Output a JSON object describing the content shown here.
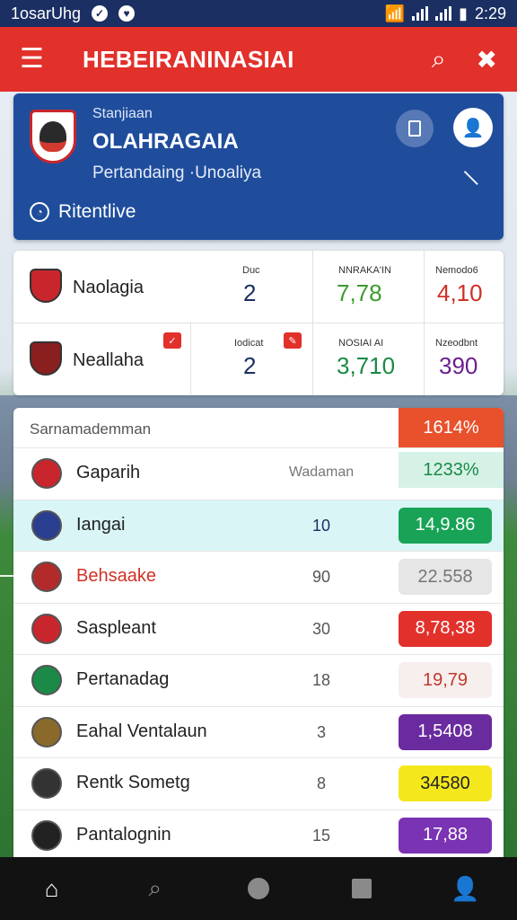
{
  "status_bar": {
    "carrier": "1osarUhg",
    "time": "2:29"
  },
  "app_bar": {
    "title": "HEBEIRANINASIAI"
  },
  "profile": {
    "subtitle": "Stanjiaan",
    "name": "OLAHRAGAIA",
    "description": "Pertandaing ·Unoaliya",
    "live_label": "Ritentlive"
  },
  "matches": [
    {
      "team": "Naolagia",
      "score_label": "Duc",
      "score": "2",
      "odd1_label": "NNRAKA'IN",
      "odd1": "7,78",
      "odd2_label": "Nemodo6",
      "odd2": "4,10",
      "odd1_color": "#3c9b2e",
      "odd2_color": "#d03025"
    },
    {
      "team": "Neallaha",
      "score_label": "Iodicat",
      "score": "2",
      "odd1_label": "NOSIAI AI",
      "odd1": "3,710",
      "odd2_label": "Nzeodbnt",
      "odd2": "390",
      "odd1_color": "#1a8a46",
      "odd2_color": "#6a1f8e"
    }
  ],
  "standings": {
    "header": "Sarnamademman",
    "header_value": "1614%",
    "rows": [
      {
        "name": "Gaparih",
        "value": "Wadaman",
        "score": "1233%",
        "pill_bg": "#d6f2e6",
        "pill_fg": "#1a8a46",
        "name_red": false,
        "highlight": false
      },
      {
        "name": "Iangai",
        "value": "10",
        "score": "14,9.86",
        "pill_bg": "#18a357",
        "pill_fg": "#ffffff",
        "name_red": false,
        "highlight": true
      },
      {
        "name": "Behsaake",
        "value": "90",
        "score": "22.558",
        "pill_bg": "#e6e6e6",
        "pill_fg": "#777777",
        "name_red": true,
        "highlight": false
      },
      {
        "name": "Saspleant",
        "value": "30",
        "score": "8,78,38",
        "pill_bg": "#e2302b",
        "pill_fg": "#ffffff",
        "name_red": false,
        "highlight": false
      },
      {
        "name": "Pertanadag",
        "value": "18",
        "score": "19,79",
        "pill_bg": "#f7eeee",
        "pill_fg": "#c0392b",
        "name_red": false,
        "highlight": false
      },
      {
        "name": "Eahal Ventalaun",
        "value": "3",
        "score": "1,5408",
        "pill_bg": "#6a2b9e",
        "pill_fg": "#ffffff",
        "name_red": false,
        "highlight": false
      },
      {
        "name": "Rentk Sometg",
        "value": "8",
        "score": "34580",
        "pill_bg": "#f4e81c",
        "pill_fg": "#222222",
        "name_red": false,
        "highlight": false
      },
      {
        "name": "Pantalognin",
        "value": "15",
        "score": "17,88",
        "pill_bg": "#7a33b3",
        "pill_fg": "#ffffff",
        "name_red": false,
        "highlight": false
      }
    ]
  }
}
